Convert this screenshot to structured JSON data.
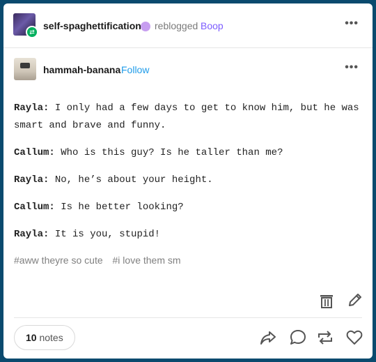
{
  "reblog": {
    "username": "self-spaghettification",
    "action": "reblogged",
    "source": "Boop"
  },
  "post": {
    "author": "hammah-banana",
    "follow_label": "Follow",
    "lines": [
      {
        "speaker": "Rayla:",
        "text": " I only had a few days to get to know him, but he was smart and brave and funny."
      },
      {
        "speaker": "Callum:",
        "text": " Who is this guy? Is he taller than me?"
      },
      {
        "speaker": "Rayla:",
        "text": " No, he’s about your height."
      },
      {
        "speaker": "Callum:",
        "text": " Is he better looking?"
      },
      {
        "speaker": "Rayla:",
        "text": " It is you, stupid!"
      }
    ],
    "tags": [
      "#aww theyre so cute",
      "#i love them sm"
    ]
  },
  "footer": {
    "notes_count": "10",
    "notes_label": "notes"
  },
  "colors": {
    "background": "#0a4a6e",
    "accent_purple": "#7c5cff",
    "follow_blue": "#1e9be9",
    "reblog_green": "#00b05e"
  }
}
